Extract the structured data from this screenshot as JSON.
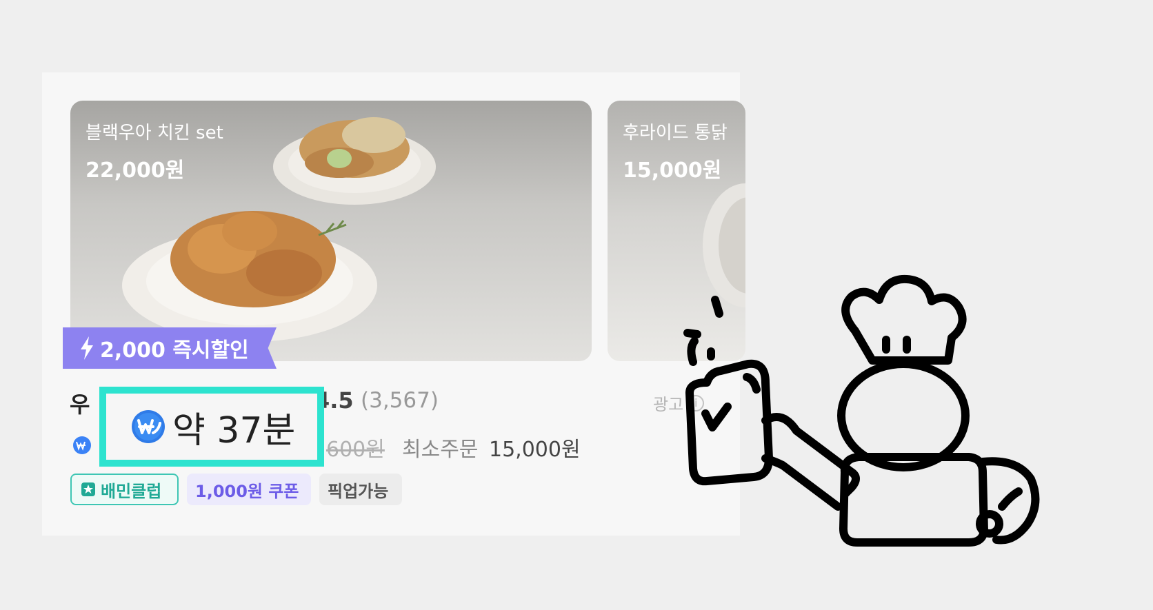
{
  "menu_items": [
    {
      "name": "블랙우아 치킨 set",
      "price": "22,000원"
    },
    {
      "name": "후라이드 통닭",
      "price": "15,000원"
    }
  ],
  "promo": {
    "label": "2,000 즉시할인",
    "icon": "lightning-icon"
  },
  "store": {
    "name_partial": "우",
    "rating": "4.5",
    "review_count": "(3,567)",
    "ad_label": "광고",
    "delivery_fee_old_partial": "600원",
    "min_order_label": "최소주문",
    "min_order_value": "15,000원"
  },
  "tags": {
    "club": "배민클럽",
    "coupon": "1,000원 쿠폰",
    "pickup": "픽업가능"
  },
  "highlight": {
    "eta": "약 37분",
    "icon": "baemin-club-w-icon"
  },
  "colors": {
    "promo": "#8d82f0",
    "highlight_border": "#2de3cf",
    "club_tag": "#3ec6b4",
    "coupon_tag_text": "#6c5ce7"
  }
}
